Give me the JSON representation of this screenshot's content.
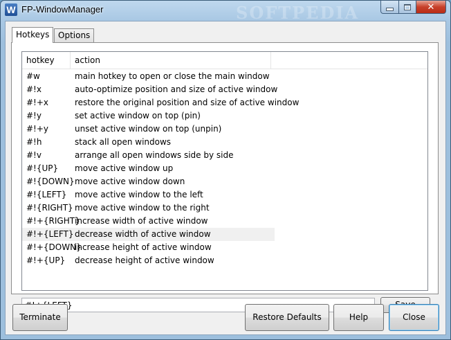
{
  "window": {
    "title": "FP-WindowManager",
    "icon_letter": "W",
    "icon": "app-w-icon",
    "caption_buttons": {
      "minimize": "minimize-icon",
      "maximize": "maximize-icon",
      "close": "✕"
    }
  },
  "watermark": "SOFTPEDIA",
  "tabs": [
    {
      "label": "Hotkeys",
      "active": true
    },
    {
      "label": "Options",
      "active": false
    }
  ],
  "table": {
    "columns": [
      "hotkey",
      "action"
    ],
    "rows": [
      {
        "hotkey": "#w",
        "action": "main hotkey to open or close the main window"
      },
      {
        "hotkey": "#!x",
        "action": "auto-optimize position and size of active window"
      },
      {
        "hotkey": "#!+x",
        "action": "restore the original position and size of active window"
      },
      {
        "hotkey": "#!y",
        "action": "set active window on top (pin)"
      },
      {
        "hotkey": "#!+y",
        "action": "unset active window on top (unpin)"
      },
      {
        "hotkey": "#!h",
        "action": "stack all open windows"
      },
      {
        "hotkey": "#!v",
        "action": "arrange all open windows side by side"
      },
      {
        "hotkey": "#!{UP}",
        "action": "move active window up"
      },
      {
        "hotkey": "#!{DOWN}",
        "action": "move active window down"
      },
      {
        "hotkey": "#!{LEFT}",
        "action": "move active window to the left"
      },
      {
        "hotkey": "#!{RIGHT}",
        "action": "move active window to the right"
      },
      {
        "hotkey": "#!+{RIGHT}",
        "action": "increase width of active window"
      },
      {
        "hotkey": "#!+{LEFT}",
        "action": "decrease width of active window",
        "selected": true
      },
      {
        "hotkey": "#!+{DOWN}",
        "action": "increase height of active window"
      },
      {
        "hotkey": "#!+{UP}",
        "action": "decrease height of active window"
      }
    ]
  },
  "hotkey_input": {
    "value": "#!+{LEFT}"
  },
  "buttons": {
    "save": "Save",
    "terminate": "Terminate",
    "restore_defaults": "Restore Defaults",
    "help": "Help",
    "close": "Close"
  },
  "colors": {
    "titlebar": "#a9c8e4",
    "close_button": "#c7402a",
    "selection": "#f0f0f0"
  }
}
